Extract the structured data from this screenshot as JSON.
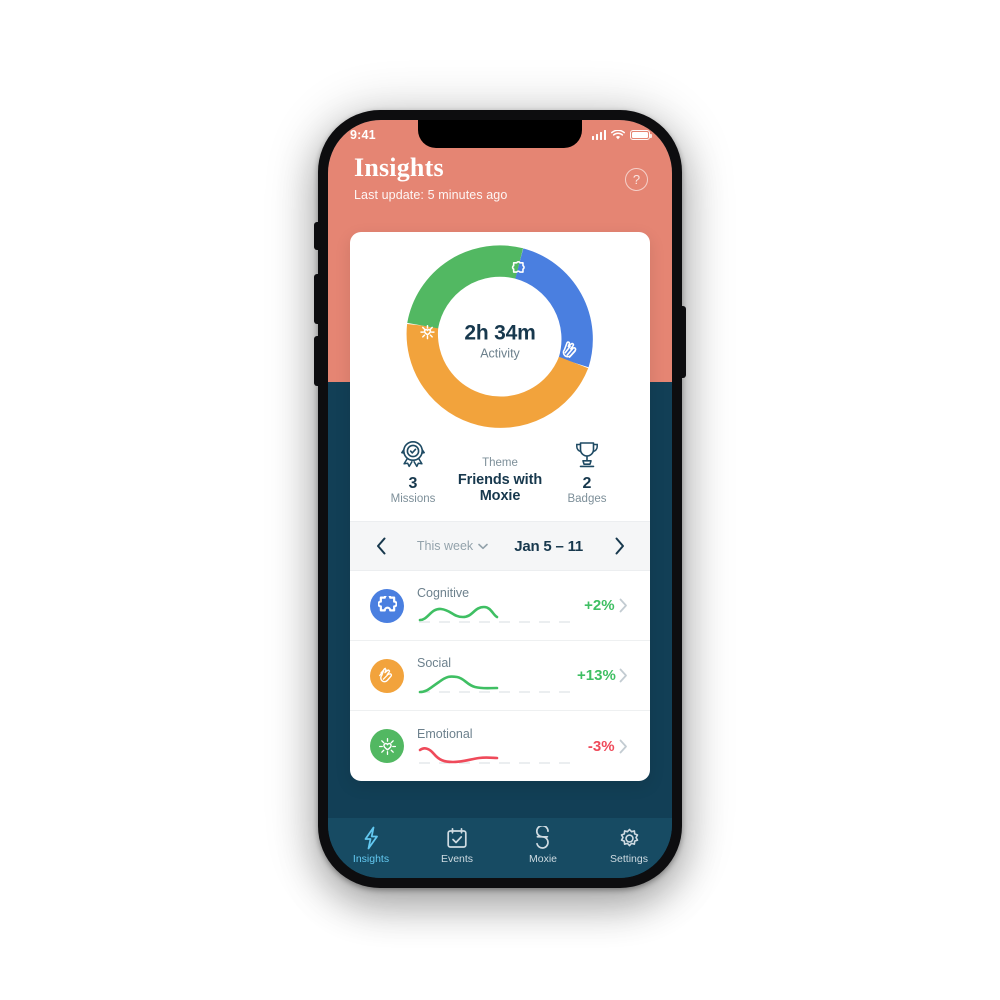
{
  "status_bar": {
    "time": "9:41",
    "signal_icon": "cellular-bars-icon",
    "wifi_icon": "wifi-icon",
    "battery_icon": "battery-icon"
  },
  "header": {
    "title": "Insights",
    "subtitle": "Last update: 5 minutes ago",
    "help_label": "?",
    "background_color": "#e58573"
  },
  "summary": {
    "donut": {
      "center_value": "2h 34m",
      "center_label": "Activity",
      "segments": [
        {
          "name": "Cognitive",
          "color": "#4a7fe0",
          "icon": "puzzle-icon",
          "percent": 27
        },
        {
          "name": "Social",
          "color": "#f2a33c",
          "icon": "clapping-hands-icon",
          "percent": 48
        },
        {
          "name": "Emotional",
          "color": "#52b862",
          "icon": "sun-heart-icon",
          "percent": 25
        }
      ]
    },
    "missions": {
      "value": "3",
      "caption": "Missions",
      "icon": "award-ribbon-icon"
    },
    "theme": {
      "caption": "Theme",
      "value": "Friends with Moxie"
    },
    "badges": {
      "value": "2",
      "caption": "Badges",
      "icon": "trophy-icon"
    }
  },
  "week_selector": {
    "prev_icon": "chevron-left-icon",
    "next_icon": "chevron-right-icon",
    "scope_label": "This week",
    "scope_caret_icon": "chevron-down-icon",
    "range_label": "Jan 5 – 11"
  },
  "metrics": [
    {
      "name": "Cognitive",
      "delta": "+2%",
      "delta_color": "#3fbf63",
      "icon": "puzzle-icon",
      "badge_color": "#4a7fe0",
      "spark_color": "#3fbf63",
      "chevron_icon": "chevron-right-icon"
    },
    {
      "name": "Social",
      "delta": "+13%",
      "delta_color": "#3fbf63",
      "icon": "clapping-hands-icon",
      "badge_color": "#f2a33c",
      "spark_color": "#3fbf63",
      "chevron_icon": "chevron-right-icon"
    },
    {
      "name": "Emotional",
      "delta": "-3%",
      "delta_color": "#ef4a5a",
      "icon": "sun-heart-icon",
      "badge_color": "#52b862",
      "spark_color": "#ef4a5a",
      "chevron_icon": "chevron-right-icon"
    }
  ],
  "chart_data": {
    "type": "pie",
    "title": "Activity",
    "categories": [
      "Cognitive",
      "Social",
      "Emotional"
    ],
    "values": [
      27,
      48,
      25
    ],
    "colors": [
      "#4a7fe0",
      "#f2a33c",
      "#52b862"
    ],
    "center_label": "2h 34m",
    "legend": "on-arc-icons",
    "sparklines": [
      {
        "name": "Cognitive",
        "color": "#3fbf63",
        "values": [
          18,
          30,
          22,
          34,
          30,
          33
        ]
      },
      {
        "name": "Social",
        "color": "#3fbf63",
        "values": [
          10,
          22,
          34,
          26,
          22,
          22
        ]
      },
      {
        "name": "Emotional",
        "color": "#ef4a5a",
        "values": [
          30,
          14,
          18,
          20,
          21,
          22
        ]
      }
    ]
  },
  "tabbar": {
    "items": [
      {
        "label": "Insights",
        "icon": "lightning-bolt-icon",
        "active": true
      },
      {
        "label": "Events",
        "icon": "calendar-check-icon",
        "active": false
      },
      {
        "label": "Moxie",
        "icon": "moxie-robot-icon",
        "active": false
      },
      {
        "label": "Settings",
        "icon": "gear-icon",
        "active": false
      }
    ]
  },
  "theme_colors": {
    "salmon": "#e58573",
    "navy": "#123f56",
    "tabbar_navy": "#174b63",
    "accent_blue": "#63c8f0"
  }
}
